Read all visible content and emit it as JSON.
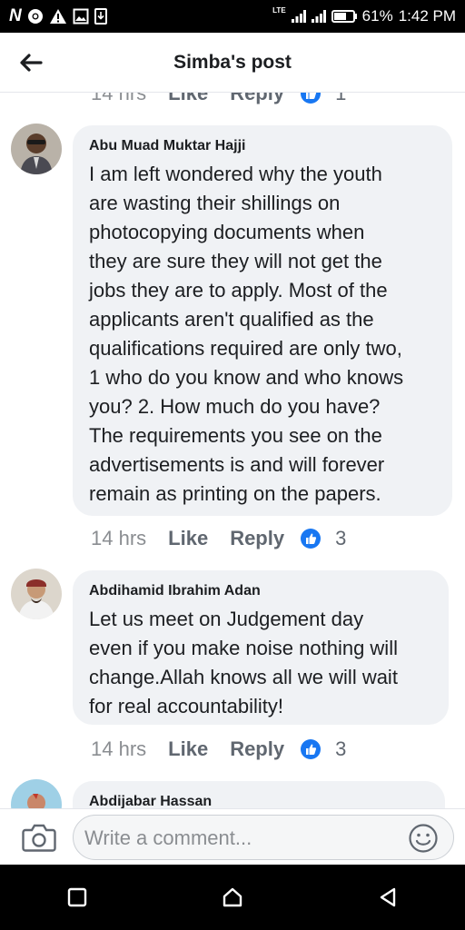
{
  "status_bar": {
    "carrier_icon": "N",
    "icons": [
      "chrome-icon",
      "warning-icon",
      "gallery-icon",
      "phone-download-icon"
    ],
    "network": "LTE",
    "battery": "61%",
    "time": "1:42 PM"
  },
  "header": {
    "title": "Simba's post",
    "back_icon": "back-arrow-icon"
  },
  "prev_meta": {
    "time": "14 hrs",
    "like": "Like",
    "reply": "Reply",
    "count": "1"
  },
  "comments": [
    {
      "author": "Abu Muad Muktar Hajji",
      "text": "I am left wondered why the youth\nare wasting their shillings on\nphotocopying documents when\nthey are sure they will not get the\njobs they are to apply. Most of the\napplicants aren't qualified as the\nqualifications required are only two,\n1 who do you know and who knows\nyou? 2. How much do you have?\nThe requirements you see on the\nadvertisements is and will forever\nremain as printing on the papers.",
      "time": "14 hrs",
      "like": "Like",
      "reply": "Reply",
      "reactions": "3"
    },
    {
      "author": "Abdihamid Ibrahim Adan",
      "text": "Let us meet on Judgement day\neven if you make noise nothing will\nchange.Allah knows all we will wait\nfor real accountability!",
      "time": "14 hrs",
      "like": "Like",
      "reply": "Reply",
      "reactions": "3"
    },
    {
      "author": "Abdijabar Hassan"
    }
  ],
  "composer": {
    "placeholder": "Write a comment...",
    "camera_icon": "camera-icon",
    "emoji_icon": "emoji-icon"
  },
  "colors": {
    "bubble": "#f0f2f5",
    "accent": "#1877f2",
    "meta_text": "#606770"
  }
}
